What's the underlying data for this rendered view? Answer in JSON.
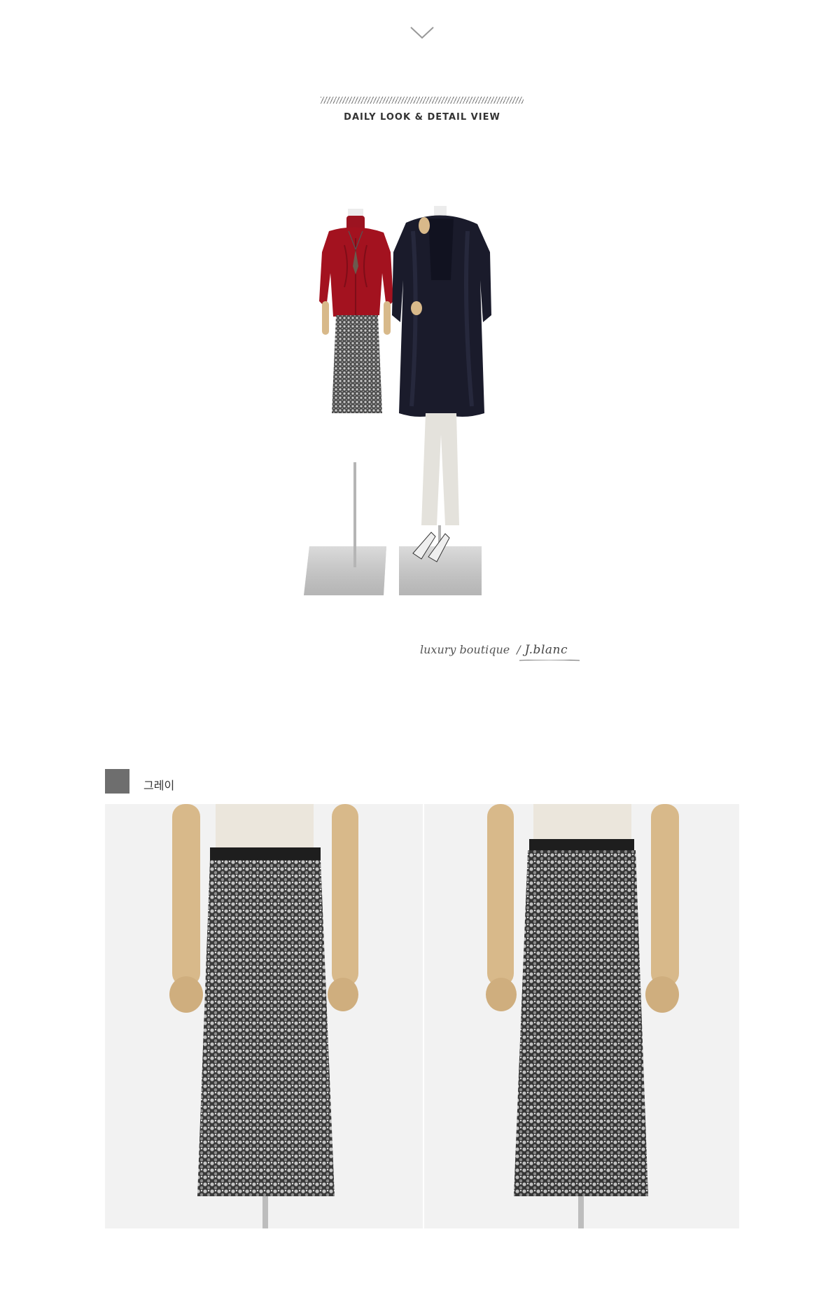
{
  "header": {
    "section_title": "DAILY LOOK & DETAIL VIEW"
  },
  "daily_look": {
    "tagline": "luxury boutique",
    "separator": "/",
    "signature": "J.blanc"
  },
  "colors_section": {
    "swatches": [
      {
        "label": "그레이",
        "color": "#6e6e6e"
      }
    ]
  },
  "palette": {
    "background": "#ffffff",
    "photo_background": "#f2f2f2",
    "sweater": "#a3121f",
    "coat": "#1a1b2b",
    "sequin_dark": "#3a3a3a",
    "sequin_light": "#bdbdbd",
    "mannequin_wood": "#d8b98a",
    "text": "#333333"
  },
  "icons": {
    "scroll_indicator": "chevron-down-icon",
    "signature_mark": "signature-icon"
  }
}
